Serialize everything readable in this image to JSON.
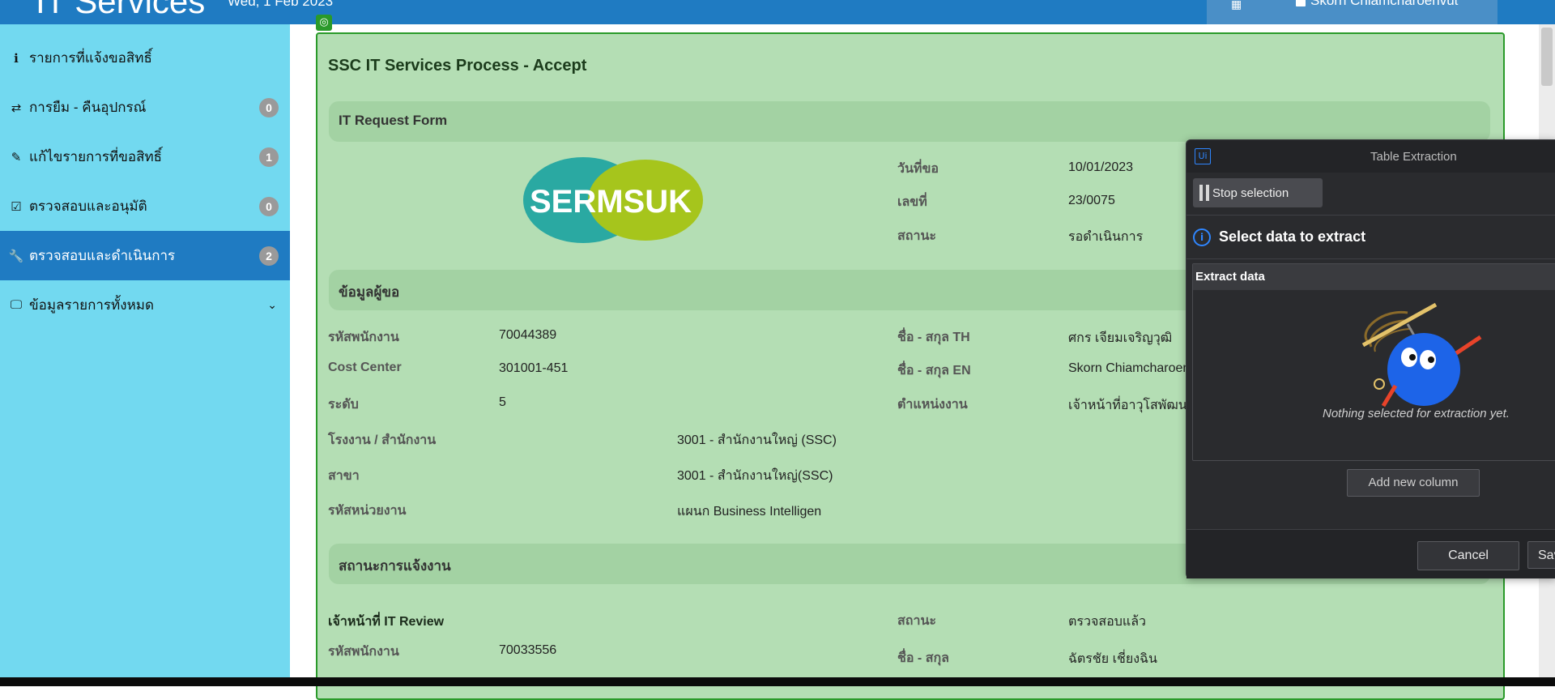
{
  "header": {
    "app_title": "IT Services",
    "date": "Wed, 1 Feb 2023",
    "user_name": "Skorn Chiamcharoenvut"
  },
  "sidebar": {
    "items": [
      {
        "icon": "info-icon",
        "label": "รายการที่แจ้งขอสิทธิ์",
        "badge": ""
      },
      {
        "icon": "retweet-icon",
        "label": "การยืม - คืนอุปกรณ์",
        "badge": "0"
      },
      {
        "icon": "pencil-icon",
        "label": "แก้ไขรายการที่ขอสิทธิ์",
        "badge": "1"
      },
      {
        "icon": "checkbox-icon",
        "label": "ตรวจสอบและอนุมัติ",
        "badge": "0"
      },
      {
        "icon": "wrench-icon",
        "label": "ตรวจสอบและดำเนินการ",
        "badge": "2",
        "active": true
      },
      {
        "icon": "monitor-icon",
        "label": "ข้อมูลรายการทั้งหมด",
        "badge": ""
      }
    ]
  },
  "main": {
    "title": "SSC IT Services Process - Accept",
    "sections": {
      "form": "IT Request Form",
      "requester": "ข้อมูลผู้ขอ",
      "status": "สถานะการแจ้งงาน"
    },
    "logo_text": "SERMSUK",
    "request": {
      "date_label": "วันที่ขอ",
      "date_value": "10/01/2023",
      "no_label": "เลขที่",
      "no_value": "23/0075",
      "status_label": "สถานะ",
      "status_value": "รอดำเนินการ"
    },
    "requester": {
      "emp_id_label": "รหัสพนักงาน",
      "emp_id_value": "70044389",
      "cost_center_label": "Cost Center",
      "cost_center_value": "301001-451",
      "level_label": "ระดับ",
      "level_value": "5",
      "name_th_label": "ชื่อ - สกุล TH",
      "name_th_value": "ศกร เจียมเจริญวุฒิ",
      "name_en_label": "ชื่อ - สกุล EN",
      "name_en_value": "Skorn Chiamcharoen",
      "position_label": "ตำแหน่งงาน",
      "position_value": "เจ้าหน้าที่อาวุโสพัฒนา",
      "plant_label": "โรงงาน / สำนักงาน",
      "plant_value": "3001 - สำนักงานใหญ่ (SSC)",
      "branch_label": "สาขา",
      "branch_value": "3001 - สำนักงานใหญ่(SSC)",
      "unit_label": "รหัสหน่วยงาน",
      "unit_value": "แผนก Business Intelligen"
    },
    "review": {
      "title": "เจ้าหน้าที่ IT Review",
      "status_label": "สถานะ",
      "status_value": "ตรวจสอบแล้ว",
      "emp_id_label": "รหัสพนักงาน",
      "emp_id_value": "70033556",
      "name_label": "ชื่อ - สกุล",
      "name_value": "ฉัตรชัย เชี่ยงฉิน"
    }
  },
  "dialog": {
    "title": "Table Extraction",
    "logo": "Ui",
    "stop_label": "Stop selection",
    "heading": "Select data to extract",
    "extract_header": "Extract data",
    "empty_text": "Nothing selected for extraction yet.",
    "add_column_label": "Add new column",
    "cancel_label": "Cancel",
    "save_label": "Save"
  },
  "colors": {
    "topbar": "#1f7bc2",
    "sidebar": "#72d9f0",
    "card": "#b4deb4",
    "card_border": "#2a9a2a",
    "dialog_bg": "#2a2b2e",
    "accent_blue": "#2f86ff"
  }
}
